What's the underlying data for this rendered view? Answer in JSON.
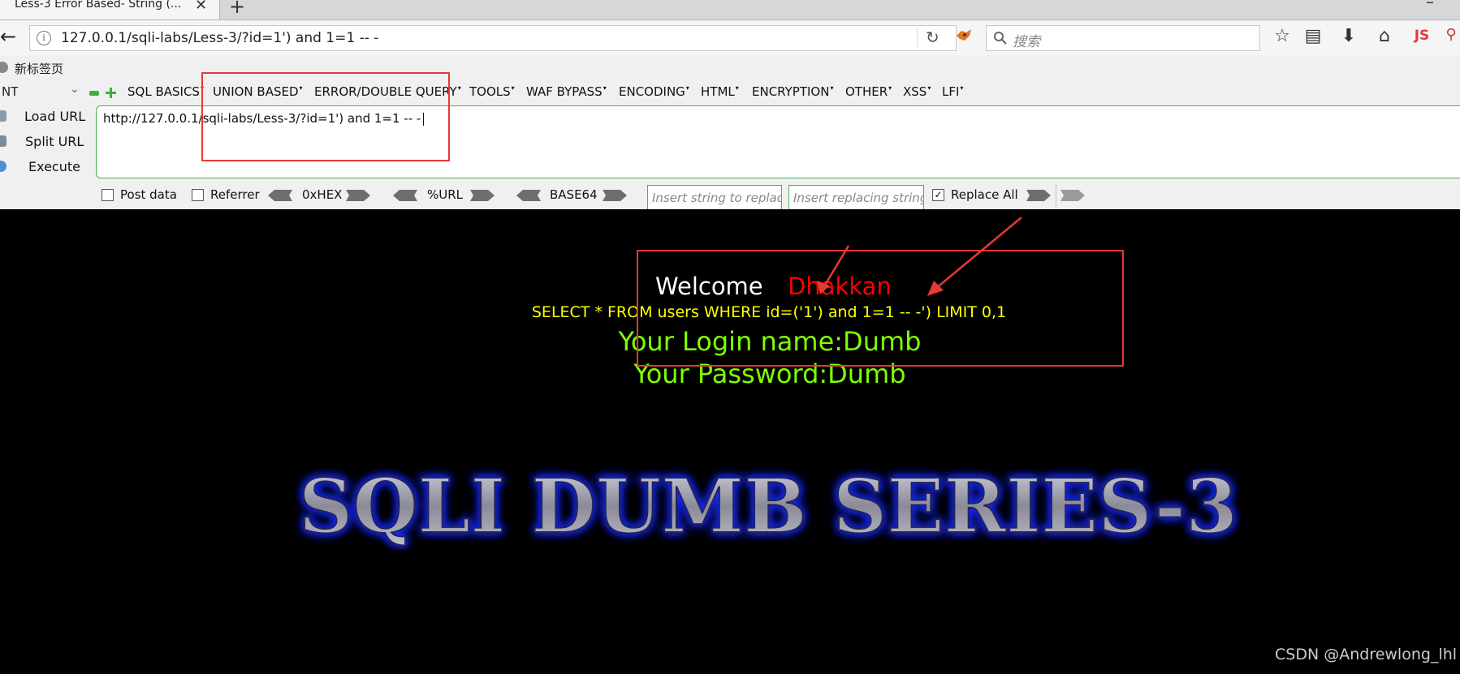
{
  "browser": {
    "tab_title": "Less-3 Error Based- String (...",
    "tab_close": "✕",
    "new_tab": "+",
    "minimize": "–",
    "back_icon": "←",
    "address": "127.0.0.1/sqli-labs/Less-3/?id=1') and 1=1 -- -",
    "reload_icon": "↻",
    "search_placeholder": "搜索",
    "toolbar_icons": [
      "star-icon",
      "reading-list-icon",
      "download-icon",
      "home-icon",
      "js-icon",
      "magnifier-icon"
    ],
    "js_label": "JS",
    "bookmark_label": "新标签页"
  },
  "hackbar": {
    "select_value": "NT",
    "menus": [
      "SQL BASICS",
      "UNION BASED",
      "ERROR/DOUBLE QUERY",
      "TOOLS",
      "WAF BYPASS",
      "ENCODING",
      "HTML",
      "ENCRYPTION",
      "OTHER",
      "XSS",
      "LFI"
    ],
    "load_url": "Load URL",
    "split_url": "Split URL",
    "execute": "Execute",
    "url_value": "http://127.0.0.1/sqli-labs/Less-3/?id=1') and 1=1 -- -",
    "post_data": "Post data",
    "referrer": "Referrer",
    "hex": "0xHEX",
    "url_enc": "%URL",
    "base64": "BASE64",
    "replace_placeholder": "Insert string to replace",
    "replacing_placeholder": "Insert replacing string",
    "replace_all": "Replace All",
    "replace_all_checked": true
  },
  "page": {
    "welcome": "Welcome",
    "name": "Dhakkan",
    "query": "SELECT * FROM users WHERE id=('1') and 1=1 -- -') LIMIT 0,1",
    "login": "Your Login name:Dumb",
    "password": "Your Password:Dumb",
    "banner": "SQLI DUMB SERIES-3",
    "watermark": "CSDN @Andrewlong_lhl"
  },
  "colors": {
    "annotation_red": "#e53935",
    "name_red": "#ff0000",
    "query_yellow": "#ffff00",
    "login_green": "#7fff00",
    "banner_glow": "#1a2bff"
  }
}
